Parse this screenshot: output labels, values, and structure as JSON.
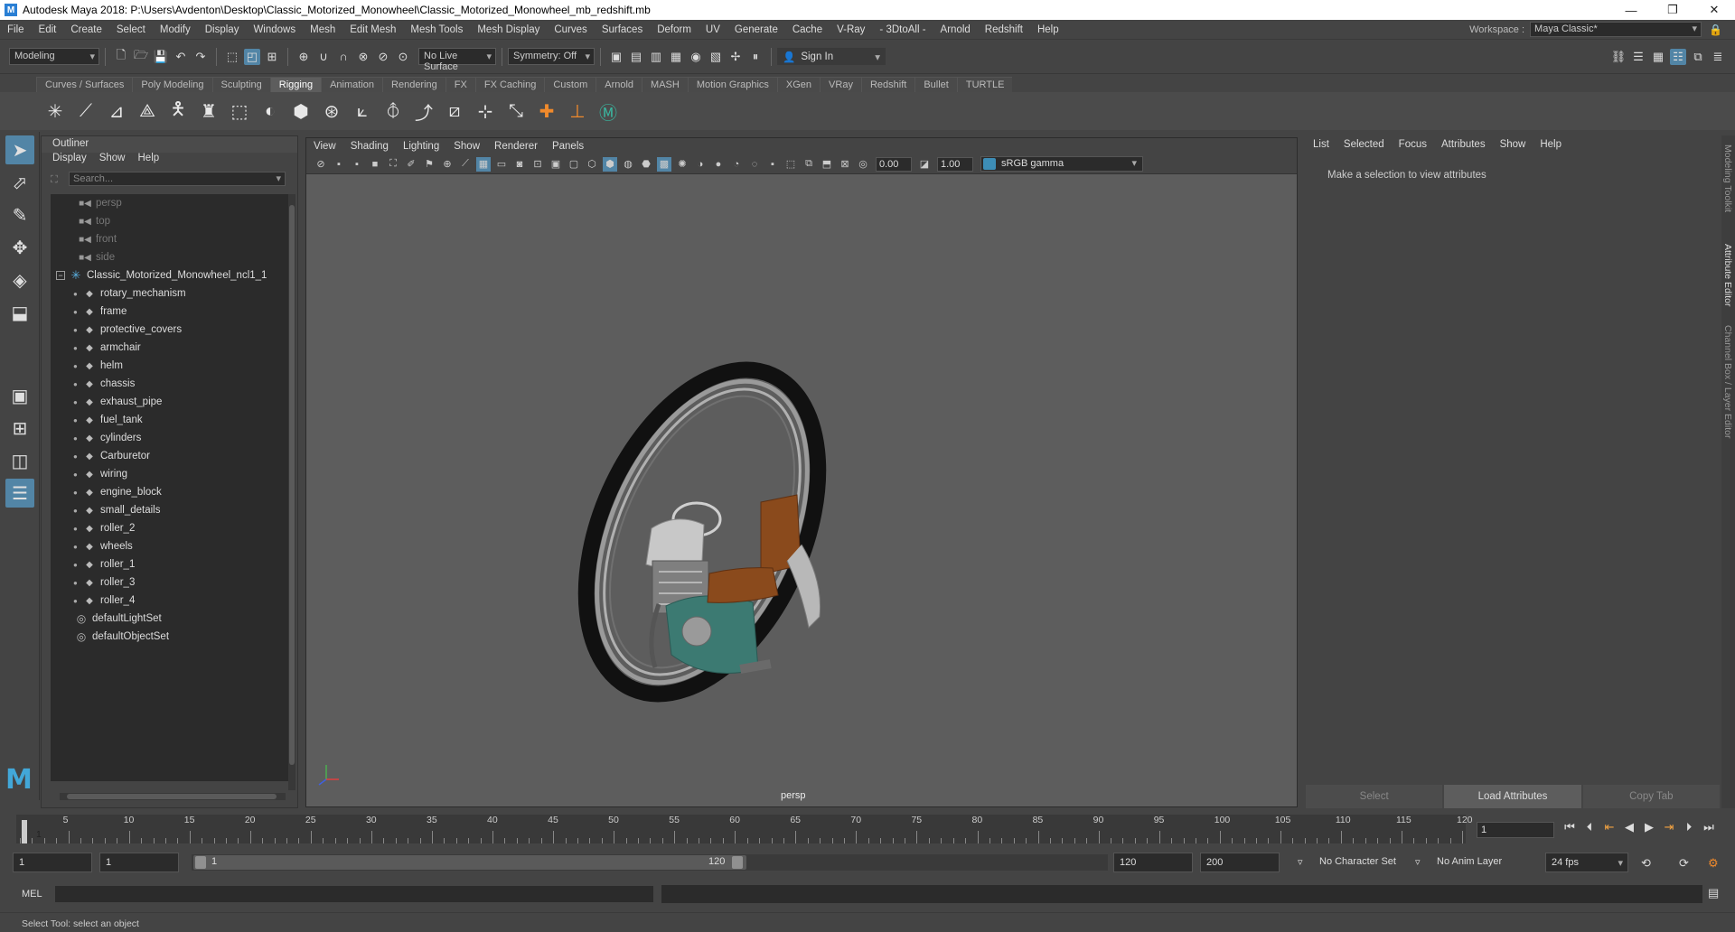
{
  "window": {
    "app_icon": "M",
    "title": "Autodesk Maya 2018: P:\\Users\\Avdenton\\Desktop\\Classic_Motorized_Monowheel\\Classic_Motorized_Monowheel_mb_redshift.mb",
    "controls": [
      "—",
      "❐",
      "✕"
    ]
  },
  "menubar": {
    "items": [
      "File",
      "Edit",
      "Create",
      "Select",
      "Modify",
      "Display",
      "Windows",
      "Mesh",
      "Edit Mesh",
      "Mesh Tools",
      "Mesh Display",
      "Curves",
      "Surfaces",
      "Deform",
      "UV",
      "Generate",
      "Cache",
      "V-Ray",
      "- 3DtoAll -",
      "Arnold",
      "Redshift",
      "Help"
    ],
    "workspace_label": "Workspace :",
    "workspace_value": "Maya Classic*"
  },
  "statusline": {
    "menuset": "Modeling",
    "live_surface": "No Live Surface",
    "symmetry": "Symmetry: Off",
    "sign_in": "Sign In"
  },
  "shelf": {
    "tabs": [
      "Curves / Surfaces",
      "Poly Modeling",
      "Sculpting",
      "Rigging",
      "Animation",
      "Rendering",
      "FX",
      "FX Caching",
      "Custom",
      "Arnold",
      "MASH",
      "Motion Graphics",
      "XGen",
      "VRay",
      "Redshift",
      "Bullet",
      "TURTLE"
    ],
    "active_tab": "Rigging"
  },
  "outliner": {
    "title": "Outliner",
    "menu": [
      "Display",
      "Show",
      "Help"
    ],
    "search_placeholder": "Search...",
    "cameras": [
      "persp",
      "top",
      "front",
      "side"
    ],
    "root": "Classic_Motorized_Monowheel_ncl1_1",
    "children": [
      "rotary_mechanism",
      "frame",
      "protective_covers",
      "armchair",
      "helm",
      "chassis",
      "exhaust_pipe",
      "fuel_tank",
      "cylinders",
      "Carburetor",
      "wiring",
      "engine_block",
      "small_details",
      "roller_2",
      "wheels",
      "roller_1",
      "roller_3",
      "roller_4"
    ],
    "sets": [
      "defaultLightSet",
      "defaultObjectSet"
    ]
  },
  "viewport": {
    "menu": [
      "View",
      "Shading",
      "Lighting",
      "Show",
      "Renderer",
      "Panels"
    ],
    "exposure": "0.00",
    "gamma_value": "1.00",
    "color_space": "sRGB gamma",
    "camera_label": "persp",
    "model_colors": {
      "tire": "#111111",
      "rim": "#9a9a9a",
      "seat": "#8a4a1c",
      "body": "#3c7a72",
      "engine": "#c8c8c8"
    }
  },
  "attribute_editor": {
    "menu": [
      "List",
      "Selected",
      "Focus",
      "Attributes",
      "Show",
      "Help"
    ],
    "message": "Make a selection to view attributes",
    "buttons": [
      "Select",
      "Load Attributes",
      "Copy Tab"
    ]
  },
  "side_tabs": [
    "Modeling Toolkit",
    "Attribute Editor",
    "Channel Box / Layer Editor"
  ],
  "timeline": {
    "ticks": [
      5,
      10,
      15,
      20,
      25,
      30,
      35,
      40,
      45,
      50,
      55,
      60,
      65,
      70,
      75,
      80,
      85,
      90,
      95,
      100,
      105,
      110,
      115,
      120
    ],
    "range_start": 1,
    "range_end": 120,
    "current_frame": "1",
    "current_field": "1"
  },
  "range_slider": {
    "start": "1",
    "playback_start": "1",
    "bar_start": "1",
    "bar_end": "120",
    "playback_end": "120",
    "end": "200",
    "character_set": "No Character Set",
    "anim_layer": "No Anim Layer",
    "fps": "24 fps"
  },
  "command_line": {
    "language": "MEL"
  },
  "help_line": "Select Tool: select an object"
}
